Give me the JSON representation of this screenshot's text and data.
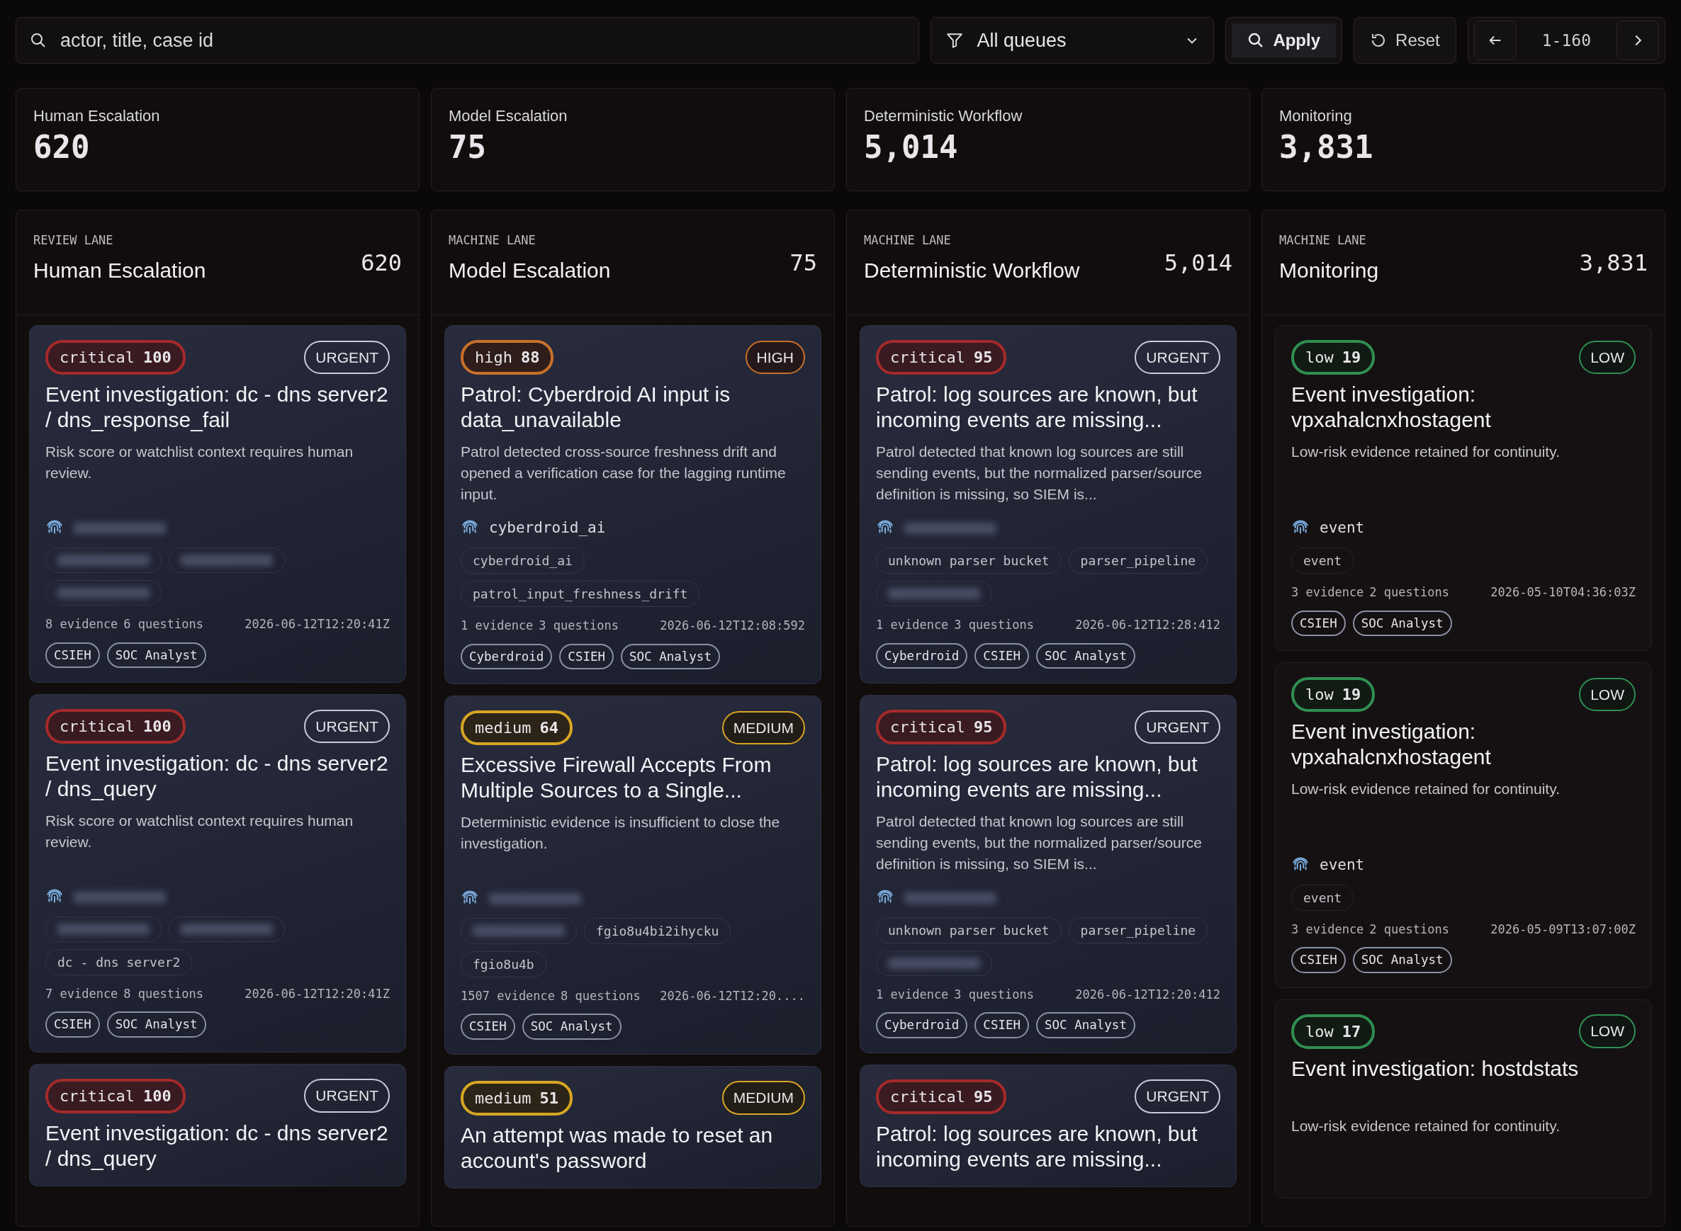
{
  "toolbar": {
    "search": {
      "placeholder": "actor, title, case id"
    },
    "queue_filter": {
      "value": "All queues"
    },
    "apply": "Apply",
    "reset": "Reset",
    "pager": {
      "range": "1-160"
    }
  },
  "stats": [
    {
      "label": "Human Escalation",
      "value": "620"
    },
    {
      "label": "Model Escalation",
      "value": "75"
    },
    {
      "label": "Deterministic Workflow",
      "value": "5,014"
    },
    {
      "label": "Monitoring",
      "value": "3,831"
    }
  ],
  "lanes": [
    {
      "eyebrow": "REVIEW LANE",
      "title": "Human Escalation",
      "count": "620",
      "cards": [
        {
          "severity": "critical",
          "score": "100",
          "priority": "URGENT",
          "title": "Event investigation: dc - dns server2 / dns_response_fail",
          "summary": "Risk score or watchlist context requires human review.",
          "actor": {
            "kind": "redacted"
          },
          "tags": [
            {
              "kind": "redacted"
            },
            {
              "kind": "redacted"
            },
            {
              "kind": "redacted"
            }
          ],
          "evidence": "8 evidence",
          "questions": "6 questions",
          "time": "2026-06-12T12:20:41Z",
          "teams": [
            "CSIEH",
            "SOC Analyst"
          ]
        },
        {
          "severity": "critical",
          "score": "100",
          "priority": "URGENT",
          "title": "Event investigation: dc - dns server2 / dns_query",
          "summary": "Risk score or watchlist context requires human review.",
          "actor": {
            "kind": "redacted"
          },
          "tags": [
            {
              "kind": "redacted"
            },
            {
              "kind": "redacted"
            },
            {
              "kind": "text",
              "text": "dc - dns server2"
            }
          ],
          "evidence": "7 evidence",
          "questions": "8 questions",
          "time": "2026-06-12T12:20:41Z",
          "teams": [
            "CSIEH",
            "SOC Analyst"
          ]
        },
        {
          "severity": "critical",
          "score": "100",
          "priority": "URGENT",
          "title": "Event investigation: dc - dns server2 / dns_query"
        }
      ]
    },
    {
      "eyebrow": "MACHINE LANE",
      "title": "Model Escalation",
      "count": "75",
      "cards": [
        {
          "severity": "high",
          "score": "88",
          "priority": "HIGH",
          "title": "Patrol: Cyberdroid AI input is data_unavailable",
          "summary": "Patrol detected cross-source freshness drift and opened a verification case for the lagging runtime input.",
          "actor": {
            "kind": "text",
            "text": "cyberdroid_ai"
          },
          "tags": [
            {
              "kind": "text",
              "text": "cyberdroid_ai"
            },
            {
              "kind": "text",
              "text": "patrol_input_freshness_drift"
            }
          ],
          "evidence": "1 evidence",
          "questions": "3 questions",
          "time": "2026-06-12T12:08:592",
          "teams": [
            "Cyberdroid",
            "CSIEH",
            "SOC Analyst"
          ]
        },
        {
          "severity": "medium",
          "score": "64",
          "priority": "MEDIUM",
          "title": "Excessive Firewall Accepts From Multiple Sources to a Single...",
          "summary": "Deterministic evidence is insufficient to close the investigation.",
          "actor": {
            "kind": "redacted"
          },
          "tags": [
            {
              "kind": "redacted"
            },
            {
              "kind": "text",
              "text": "fgio8u4bi2ihycku"
            },
            {
              "kind": "text",
              "text": "fgio8u4b"
            }
          ],
          "evidence": "1507 evidence",
          "questions": "8 questions",
          "time": "2026-06-12T12:20....",
          "teams": [
            "CSIEH",
            "SOC Analyst"
          ]
        },
        {
          "severity": "medium",
          "score": "51",
          "priority": "MEDIUM",
          "title": "An attempt was made to reset an account's password"
        }
      ]
    },
    {
      "eyebrow": "MACHINE LANE",
      "title": "Deterministic Workflow",
      "count": "5,014",
      "cards": [
        {
          "severity": "critical",
          "score": "95",
          "priority": "URGENT",
          "title": "Patrol: log sources are known, but incoming events are missing...",
          "summary": "Patrol detected that known log sources are still sending events, but the normalized parser/source definition is missing, so SIEM is...",
          "actor": {
            "kind": "redacted"
          },
          "tags": [
            {
              "kind": "text",
              "text": "unknown parser bucket"
            },
            {
              "kind": "text",
              "text": "parser_pipeline"
            },
            {
              "kind": "redacted"
            }
          ],
          "evidence": "1 evidence",
          "questions": "3 questions",
          "time": "2026-06-12T12:28:412",
          "teams": [
            "Cyberdroid",
            "CSIEH",
            "SOC Analyst"
          ]
        },
        {
          "severity": "critical",
          "score": "95",
          "priority": "URGENT",
          "title": "Patrol: log sources are known, but incoming events are missing...",
          "summary": "Patrol detected that known log sources are still sending events, but the normalized parser/source definition is missing, so SIEM is...",
          "actor": {
            "kind": "redacted"
          },
          "tags": [
            {
              "kind": "text",
              "text": "unknown parser bucket"
            },
            {
              "kind": "text",
              "text": "parser_pipeline"
            },
            {
              "kind": "redacted"
            }
          ],
          "evidence": "1 evidence",
          "questions": "3 questions",
          "time": "2026-06-12T12:20:412",
          "teams": [
            "Cyberdroid",
            "CSIEH",
            "SOC Analyst"
          ]
        },
        {
          "severity": "critical",
          "score": "95",
          "priority": "URGENT",
          "title": "Patrol: log sources are known, but incoming events are missing..."
        }
      ]
    },
    {
      "eyebrow": "MACHINE LANE",
      "title": "Monitoring",
      "count": "3,831",
      "cards": [
        {
          "severity": "low",
          "score": "19",
          "priority": "LOW",
          "title": "Event investigation: vpxahalcnxhostagent",
          "summary": "Low-risk evidence retained for continuity.",
          "actor": {
            "kind": "text",
            "text": "event"
          },
          "tags": [
            {
              "kind": "text",
              "text": "event"
            }
          ],
          "evidence": "3 evidence",
          "questions": "2 questions",
          "time": "2026-05-10T04:36:03Z",
          "teams": [
            "CSIEH",
            "SOC Analyst"
          ]
        },
        {
          "severity": "low",
          "score": "19",
          "priority": "LOW",
          "title": "Event investigation: vpxahalcnxhostagent",
          "summary": "Low-risk evidence retained for continuity.",
          "actor": {
            "kind": "text",
            "text": "event"
          },
          "tags": [
            {
              "kind": "text",
              "text": "event"
            }
          ],
          "evidence": "3 evidence",
          "questions": "2 questions",
          "time": "2026-05-09T13:07:00Z",
          "teams": [
            "CSIEH",
            "SOC Analyst"
          ]
        },
        {
          "severity": "low",
          "score": "17",
          "priority": "LOW",
          "title": "Event investigation: hostdstats",
          "summary": "Low-risk evidence retained for continuity."
        }
      ]
    }
  ]
}
